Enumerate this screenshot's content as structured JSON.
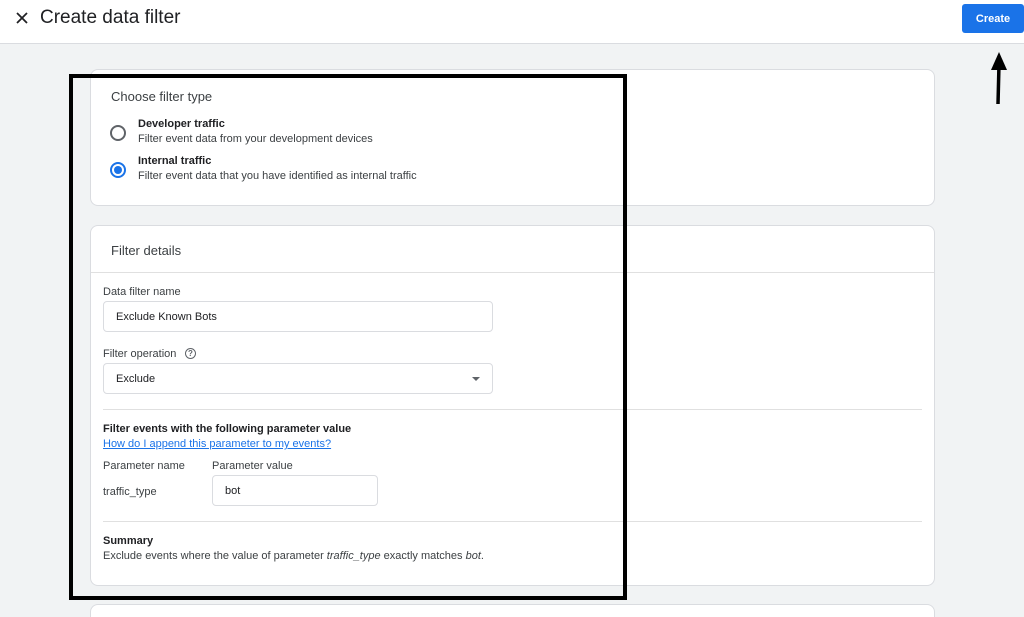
{
  "header": {
    "title": "Create data filter",
    "create_label": "Create"
  },
  "filter_type": {
    "title": "Choose filter type",
    "options": [
      {
        "label": "Developer traffic",
        "description": "Filter event data from your development devices",
        "selected": false
      },
      {
        "label": "Internal traffic",
        "description": "Filter event data that you have identified as internal traffic",
        "selected": true
      }
    ]
  },
  "details": {
    "title": "Filter details",
    "name_label": "Data filter name",
    "name_value": "Exclude Known Bots",
    "operation_label": "Filter operation",
    "operation_value": "Exclude",
    "param_heading": "Filter events with the following parameter value",
    "param_link": "How do I append this parameter to my events?",
    "param_name_label": "Parameter name",
    "param_value_label": "Parameter value",
    "param_name": "traffic_type",
    "param_value": "bot",
    "summary_heading": "Summary",
    "summary_prefix": "Exclude events where the value of parameter ",
    "summary_param": "traffic_type",
    "summary_middle": " exactly matches ",
    "summary_value": "bot",
    "summary_suffix": "."
  },
  "icons": {
    "close": "close-icon",
    "help": "help-icon",
    "dropdown": "caret-down-icon"
  },
  "colors": {
    "accent": "#1a73e8",
    "background": "#f1f3f4"
  }
}
